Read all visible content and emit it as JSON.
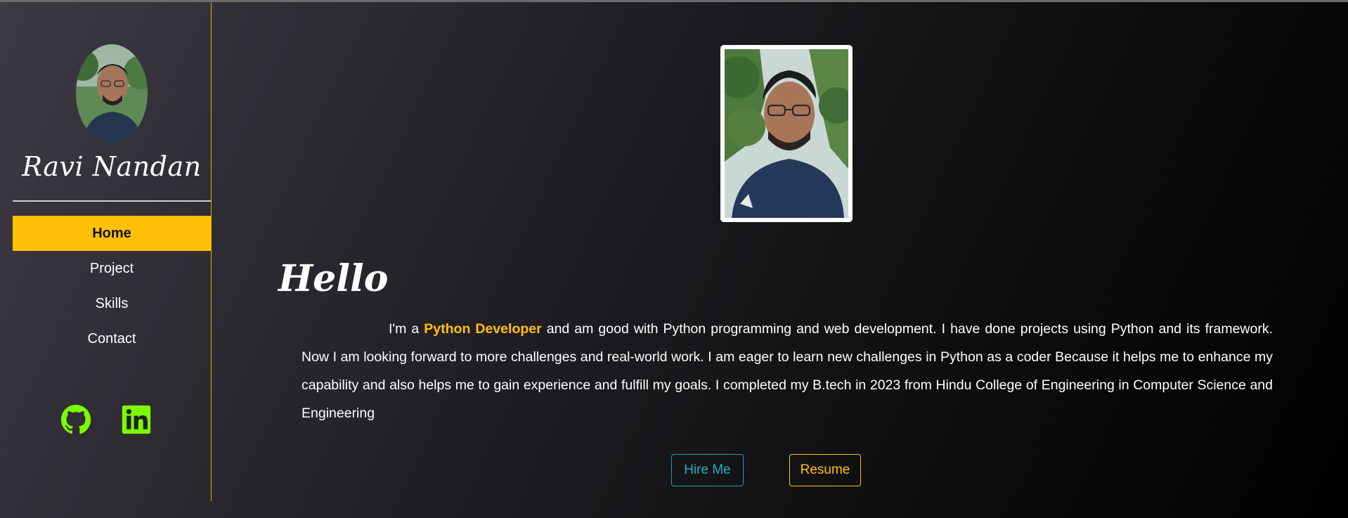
{
  "sidebar": {
    "name": "Ravi Nandan",
    "nav": [
      {
        "label": "Home",
        "active": true
      },
      {
        "label": "Project",
        "active": false
      },
      {
        "label": "Skills",
        "active": false
      },
      {
        "label": "Contact",
        "active": false
      }
    ],
    "socials": [
      {
        "icon": "github-icon",
        "color": "#7cfc00"
      },
      {
        "icon": "linkedin-icon",
        "color": "#7cfc00"
      }
    ]
  },
  "main": {
    "greeting": "Hello",
    "intro_prefix": "I'm a ",
    "role": "Python Developer",
    "intro_rest": " and am good with Python programming and web development. I have done projects using Python and its framework. Now I am looking forward to more challenges and real-world work. I am eager to learn new challenges in Python as a coder Because it helps me to enhance my capability and also helps me to gain experience and fulfill my goals. I completed my B.tech in 2023 from Hindu College of Engineering in Computer Science and Engineering",
    "buttons": {
      "hire": "Hire Me",
      "resume": "Resume"
    }
  },
  "colors": {
    "accent": "#ffc107",
    "hire": "#17a2b8",
    "social": "#7cfc00"
  }
}
